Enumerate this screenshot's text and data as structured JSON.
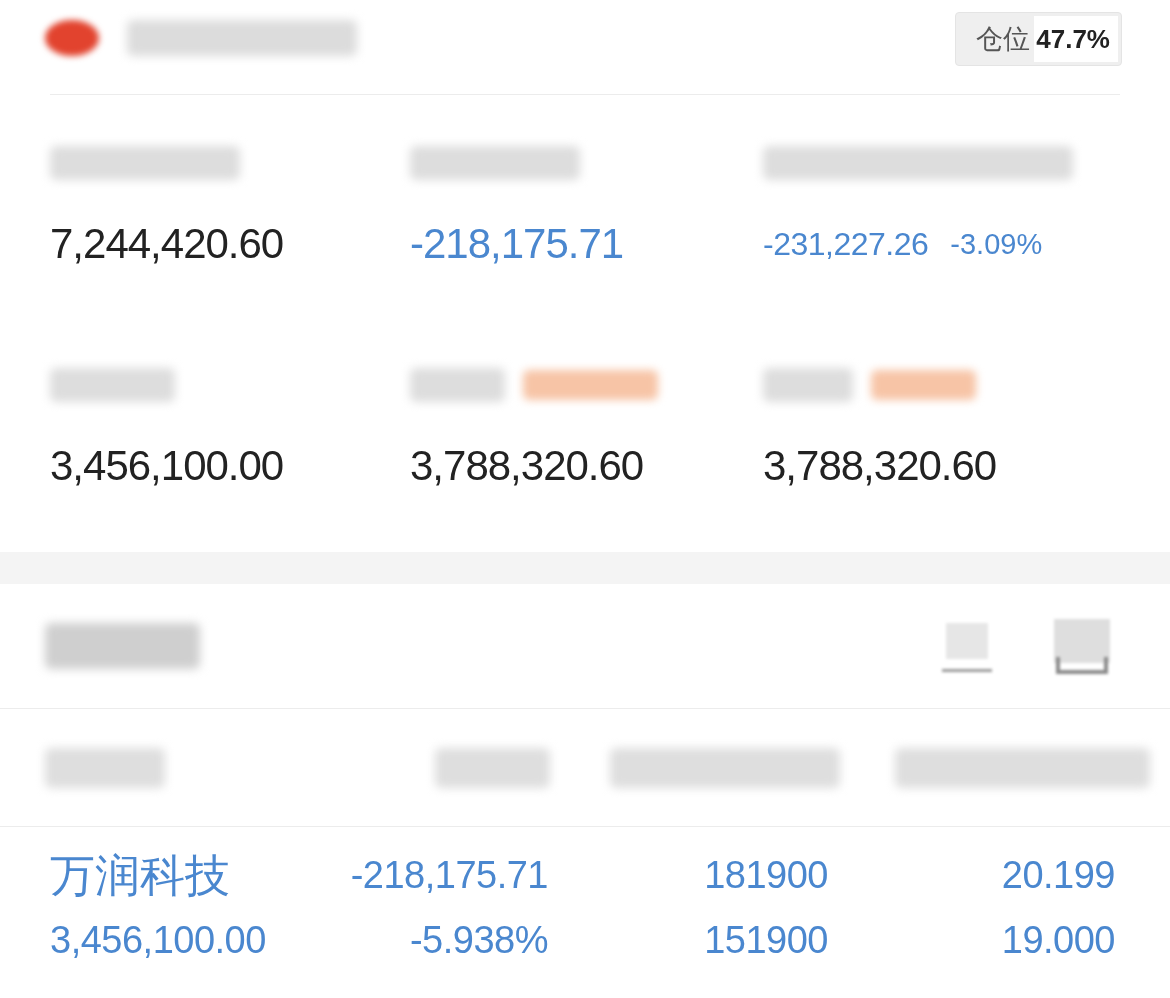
{
  "header": {
    "position_badge": {
      "label": "仓位",
      "value": "47.7%"
    }
  },
  "summary": {
    "stats": [
      {
        "kind": "single",
        "value": "7,244,420.60",
        "color": "#222222",
        "badge": false
      },
      {
        "kind": "single",
        "value": "-218,175.71",
        "color": "#4a87cf",
        "badge": false
      },
      {
        "kind": "pair",
        "value": "-231,227.26",
        "percent": "-3.09%",
        "color": "#4a87cf",
        "badge": false
      },
      {
        "kind": "single",
        "value": "3,456,100.00",
        "color": "#222222",
        "badge": false
      },
      {
        "kind": "single",
        "value": "3,788,320.60",
        "color": "#222222",
        "badge": true
      },
      {
        "kind": "single",
        "value": "3,788,320.60",
        "color": "#222222",
        "badge": true
      }
    ]
  },
  "holdings": {
    "rows": [
      {
        "color": "#4a87cf",
        "cells": [
          {
            "line_1": "万润科技",
            "line_2": "3,456,100.00"
          },
          {
            "line_1": "-218,175.71",
            "line_2": "-5.938%"
          },
          {
            "line_1": "181900",
            "line_2": "151900"
          },
          {
            "line_1": "20.199",
            "line_2": "19.000"
          }
        ]
      }
    ]
  }
}
